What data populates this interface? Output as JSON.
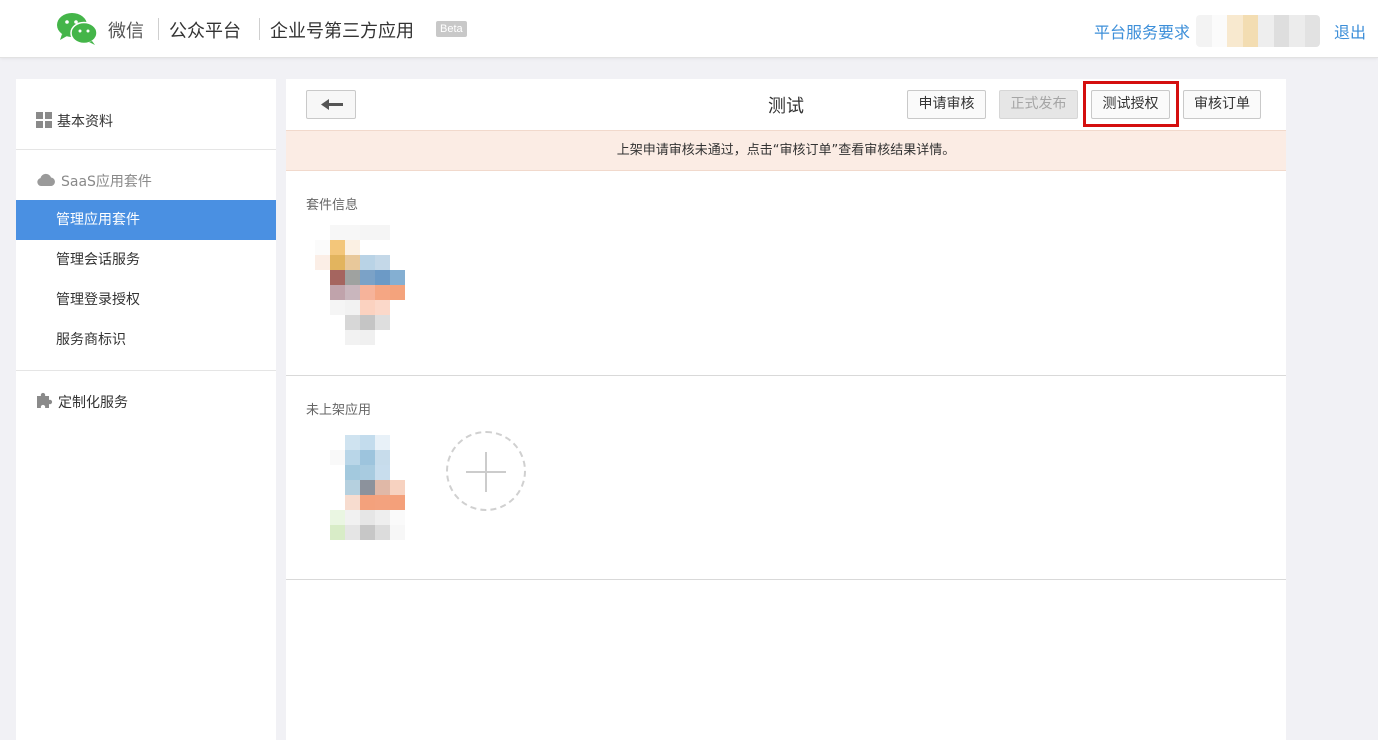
{
  "header": {
    "wechat": "微信",
    "platform": "公众平台",
    "enterprise": "企业号第三方应用",
    "beta": "Beta",
    "service_link": "平台服务要求",
    "logout": "退出"
  },
  "sidebar": {
    "basic_info": "基本资料",
    "saas_group": "SaaS应用套件",
    "items": [
      {
        "label": "管理应用套件",
        "active": true
      },
      {
        "label": "管理会话服务",
        "active": false
      },
      {
        "label": "管理登录授权",
        "active": false
      },
      {
        "label": "服务商标识",
        "active": false
      }
    ],
    "custom_service": "定制化服务"
  },
  "main": {
    "title": "测试",
    "buttons": {
      "apply_review": "申请审核",
      "publish": "正式发布",
      "test_auth": "测试授权",
      "review_order": "审核订单"
    },
    "notice": "上架申请审核未通过，点击“审核订单”查看审核结果详情。",
    "suite_section": "套件信息",
    "unlisted_section": "未上架应用"
  },
  "colors": {
    "accent": "#4a90e2",
    "link": "#3d8fd9",
    "highlight_border": "#d40f0f",
    "notice_bg": "#fbece4"
  }
}
